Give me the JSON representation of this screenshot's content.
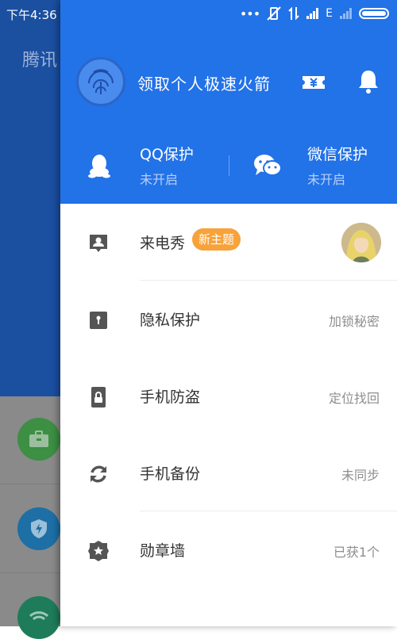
{
  "status_bar": {
    "time": "下午4:36",
    "network_label": "E"
  },
  "background_app": {
    "title": "腾讯"
  },
  "drawer": {
    "header": {
      "rocket_text": "领取个人极速火箭",
      "protections": [
        {
          "title": "QQ保护",
          "status": "未开启",
          "icon": "qq-penguin-icon"
        },
        {
          "title": "微信保护",
          "status": "未开启",
          "icon": "wechat-icon"
        }
      ]
    },
    "menu": [
      {
        "label": "来电秀",
        "badge": "新主题",
        "value": "",
        "icon": "call-show-icon"
      },
      {
        "label": "隐私保护",
        "value": "加锁秘密",
        "icon": "privacy-lock-icon"
      },
      {
        "label": "手机防盗",
        "value": "定位找回",
        "icon": "phone-antitheft-icon"
      },
      {
        "label": "手机备份",
        "value": "未同步",
        "icon": "backup-sync-icon"
      },
      {
        "label": "勋章墙",
        "value": "已获1个",
        "icon": "medal-icon"
      }
    ]
  },
  "colors": {
    "header_blue": "#2272e8",
    "background_blue": "#1b4fa0",
    "badge_orange": "#f7a23a",
    "icon_gray": "#555555"
  }
}
